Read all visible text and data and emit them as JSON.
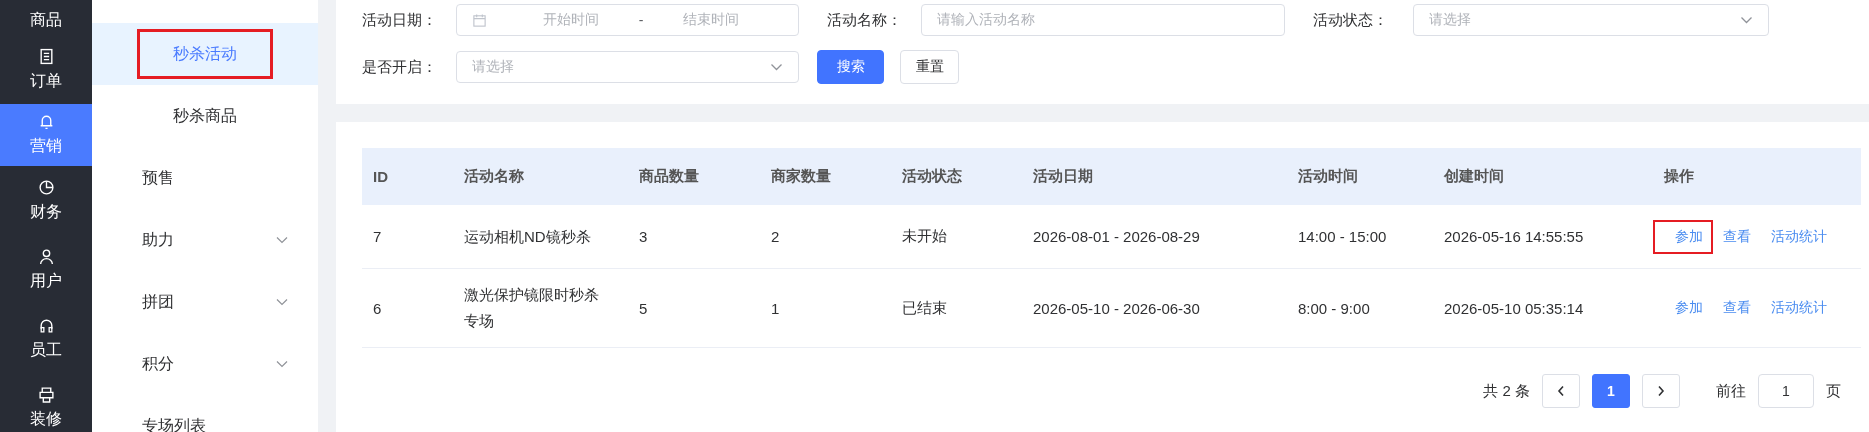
{
  "nav": [
    {
      "label": "商品",
      "selected": false
    },
    {
      "label": "订单",
      "selected": false
    },
    {
      "label": "营销",
      "selected": true
    },
    {
      "label": "财务",
      "selected": false
    },
    {
      "label": "用户",
      "selected": false
    },
    {
      "label": "员工",
      "selected": false
    },
    {
      "label": "装修",
      "selected": false
    }
  ],
  "submenu": [
    {
      "label": "秒杀活动",
      "kind": "child",
      "selected": true,
      "highlighted": true
    },
    {
      "label": "秒杀商品",
      "kind": "child",
      "selected": false,
      "highlighted": false
    },
    {
      "label": "预售",
      "kind": "item",
      "selected": false,
      "highlighted": false
    },
    {
      "label": "助力",
      "kind": "group",
      "expanded": false,
      "selected": false,
      "highlighted": false
    },
    {
      "label": "拼团",
      "kind": "group",
      "expanded": false,
      "selected": false,
      "highlighted": false
    },
    {
      "label": "积分",
      "kind": "group",
      "expanded": false,
      "selected": false,
      "highlighted": false
    },
    {
      "label": "专场列表",
      "kind": "item",
      "selected": false,
      "highlighted": false
    }
  ],
  "filters": [
    {
      "label": "活动日期：",
      "kind": "daterange",
      "start_placeholder": "开始时间",
      "separator": "-",
      "end_placeholder": "结束时间"
    },
    {
      "label": "活动名称：",
      "kind": "text",
      "placeholder": "请输入活动名称"
    },
    {
      "label": "活动状态：",
      "kind": "select",
      "placeholder": "请选择"
    },
    {
      "label": "是否开启：",
      "kind": "select",
      "placeholder": "请选择"
    }
  ],
  "buttons": [
    {
      "label": "搜索",
      "kind": "primary"
    },
    {
      "label": "重置",
      "kind": "default"
    }
  ],
  "table": {
    "columns": [
      "ID",
      "活动名称",
      "商品数量",
      "商家数量",
      "活动状态",
      "活动日期",
      "活动时间",
      "创建时间",
      "操作"
    ],
    "rows": [
      {
        "cells": [
          "7",
          "运动相机ND镜秒杀",
          "3",
          "2",
          "未开始",
          "2026-08-01 - 2026-08-29",
          "14:00 - 15:00",
          "2026-05-16 14:55:55"
        ],
        "actions": [
          {
            "label": "参加",
            "highlighted": true
          },
          {
            "label": "查看",
            "highlighted": false
          },
          {
            "label": "活动统计",
            "highlighted": false
          }
        ]
      },
      {
        "cells": [
          "6",
          "激光保护镜限时秒杀专场",
          "5",
          "1",
          "已结束",
          "2026-05-10 - 2026-06-30",
          "8:00 - 9:00",
          "2026-05-10 05:35:14"
        ],
        "actions": [
          {
            "label": "参加",
            "highlighted": false
          },
          {
            "label": "查看",
            "highlighted": false
          },
          {
            "label": "活动统计",
            "highlighted": false
          }
        ]
      }
    ]
  },
  "pagination": {
    "total": "共 2 条",
    "pages": [
      {
        "label": "1",
        "selected": true
      }
    ],
    "goto_label": "前往",
    "goto_value": "1",
    "suffix": "页"
  }
}
